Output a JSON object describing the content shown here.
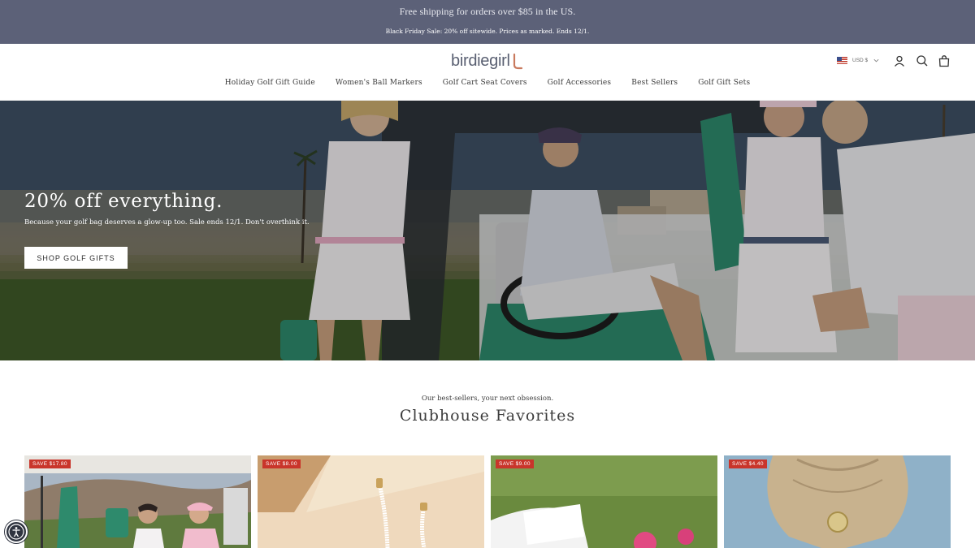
{
  "announcement": {
    "line1": "Free shipping for orders over $85 in the US.",
    "line2": "Black Friday Sale: 20% off sitewide. Prices as marked. Ends 12/1."
  },
  "header": {
    "logo": "birdiegirl",
    "currency": "USD $",
    "icons": [
      "account-icon",
      "search-icon",
      "cart-icon"
    ]
  },
  "nav": {
    "items": [
      "Holiday Golf Gift Guide",
      "Women's Ball Markers",
      "Golf Cart Seat Covers",
      "Golf Accessories",
      "Best Sellers",
      "Golf Gift Sets"
    ]
  },
  "hero": {
    "title": "20% off everything.",
    "subtitle": "Because your golf bag deserves a glow-up too. Sale ends 12/1. Don't overthink it.",
    "cta": "SHOP GOLF GIFTS"
  },
  "section": {
    "eyebrow": "Our best-sellers, your next obsession.",
    "title": "Clubhouse Favorites"
  },
  "products": [
    {
      "badge": "SAVE $17.80"
    },
    {
      "badge": "SAVE $8.00"
    },
    {
      "badge": "SAVE $9.00"
    },
    {
      "badge": "SAVE $4.40"
    }
  ],
  "colors": {
    "announcement_bg": "#5c6178",
    "badge": "#c9352b",
    "accent_green": "#2e8a6c"
  }
}
